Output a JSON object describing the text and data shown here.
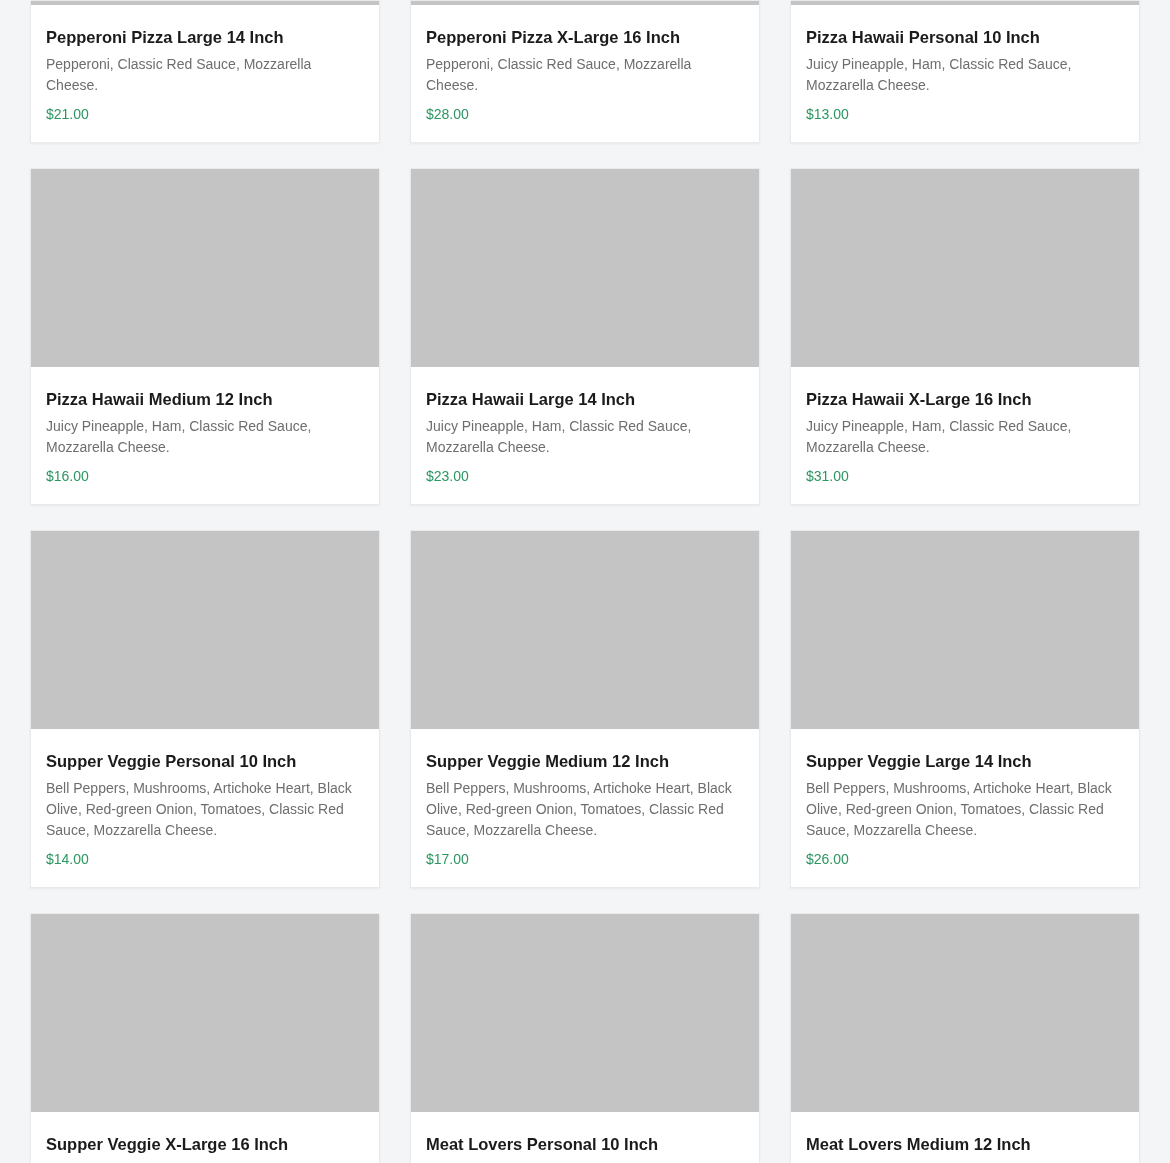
{
  "products": [
    {
      "name": "Pepperoni Pizza Large 14 Inch",
      "description": "Pepperoni, Classic Red Sauce, Mozzarella Cheese.",
      "price": "$21.00"
    },
    {
      "name": "Pepperoni Pizza X-Large 16 Inch",
      "description": "Pepperoni, Classic Red Sauce, Mozzarella Cheese.",
      "price": "$28.00"
    },
    {
      "name": "Pizza Hawaii Personal 10 Inch",
      "description": "Juicy Pineapple, Ham, Classic Red Sauce, Mozzarella Cheese.",
      "price": "$13.00"
    },
    {
      "name": "Pizza Hawaii Medium 12 Inch",
      "description": "Juicy Pineapple, Ham, Classic Red Sauce, Mozzarella Cheese.",
      "price": "$16.00"
    },
    {
      "name": "Pizza Hawaii Large 14 Inch",
      "description": "Juicy Pineapple, Ham, Classic Red Sauce, Mozzarella Cheese.",
      "price": "$23.00"
    },
    {
      "name": "Pizza Hawaii X-Large 16 Inch",
      "description": "Juicy Pineapple, Ham, Classic Red Sauce, Mozzarella Cheese.",
      "price": "$31.00"
    },
    {
      "name": "Supper Veggie Personal 10 Inch",
      "description": "Bell Peppers, Mushrooms, Artichoke Heart, Black Olive, Red-green Onion, Tomatoes, Classic Red Sauce, Mozzarella Cheese.",
      "price": "$14.00"
    },
    {
      "name": "Supper Veggie Medium 12 Inch",
      "description": "Bell Peppers, Mushrooms, Artichoke Heart, Black Olive, Red-green Onion, Tomatoes, Classic Red Sauce, Mozzarella Cheese.",
      "price": "$17.00"
    },
    {
      "name": "Supper Veggie Large 14 Inch",
      "description": "Bell Peppers, Mushrooms, Artichoke Heart, Black Olive, Red-green Onion, Tomatoes, Classic Red Sauce, Mozzarella Cheese.",
      "price": "$26.00"
    },
    {
      "name": "Supper Veggie X-Large 16 Inch"
    },
    {
      "name": "Meat Lovers Personal 10 Inch"
    },
    {
      "name": "Meat Lovers Medium 12 Inch"
    }
  ]
}
